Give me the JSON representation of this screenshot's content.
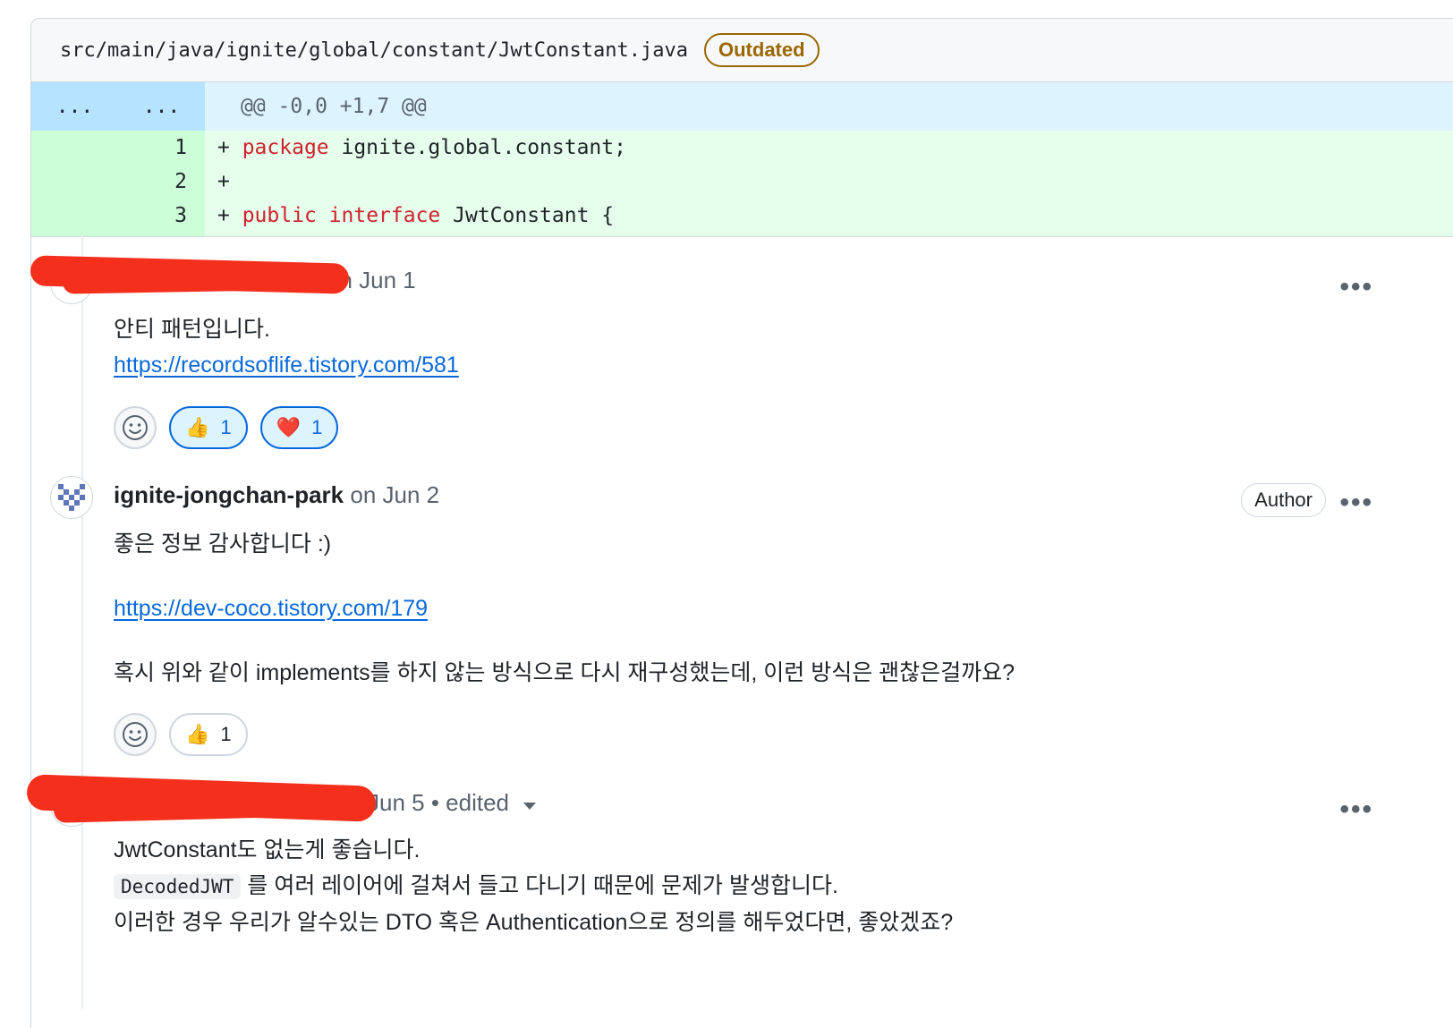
{
  "file": {
    "path": "src/main/java/ignite/global/constant/JwtConstant.java",
    "badge": "Outdated"
  },
  "diff": {
    "hunk_old": "...",
    "hunk_new": "...",
    "hunk_header": "@@ -0,0 +1,7 @@",
    "lines": [
      {
        "num": "1",
        "prefix": "+ ",
        "keyword1": "package",
        "rest": " ignite.global.constant;"
      },
      {
        "num": "2",
        "prefix": "+",
        "keyword1": "",
        "rest": ""
      },
      {
        "num": "3",
        "prefix": "+ ",
        "keyword1": "public",
        "keyword2": "interface",
        "rest": " JwtConstant {"
      }
    ]
  },
  "comments": [
    {
      "author": "",
      "meta": "on Jun 1",
      "body": [
        "안티 패턴입니다."
      ],
      "link": "https://recordsoflife.tistory.com/581",
      "reactions": [
        {
          "emoji": "👍",
          "count": "1"
        },
        {
          "emoji": "❤️",
          "count": "1"
        }
      ]
    },
    {
      "author": "ignite-jongchan-park",
      "meta": "on Jun 2",
      "badge": "Author",
      "body1": "좋은 정보 감사합니다 :)",
      "link": "https://dev-coco.tistory.com/179",
      "body2": "혹시 위와 같이 implements를 하지 않는 방식으로 다시 재구성했는데, 이런 방식은 괜찮은걸까요?",
      "reactions": [
        {
          "emoji": "👍",
          "count": "1"
        }
      ]
    },
    {
      "author": "",
      "meta": "Jun 5 • edited",
      "line1": "JwtConstant도 없는게 좋습니다.",
      "code": "DecodedJWT",
      "line2_rest": " 를 여러 레이어에 걸쳐서 들고 다니기 때문에 문제가 발생합니다.",
      "line3": "이러한 경우 우리가 알수있는 DTO 혹은 Authentication으로 정의를 해두었다면, 좋았겠죠?"
    }
  ],
  "icons": {
    "more": "kebab-horizontal-icon",
    "smiley": "smiley-icon",
    "caret": "triangle-down-icon"
  },
  "colors": {
    "link": "#0969da",
    "add_bg": "#e6ffec",
    "hunk_bg": "#ddf4ff",
    "keyword": "#cf222e",
    "outdated": "#9a6700",
    "redaction": "#f4301d"
  }
}
